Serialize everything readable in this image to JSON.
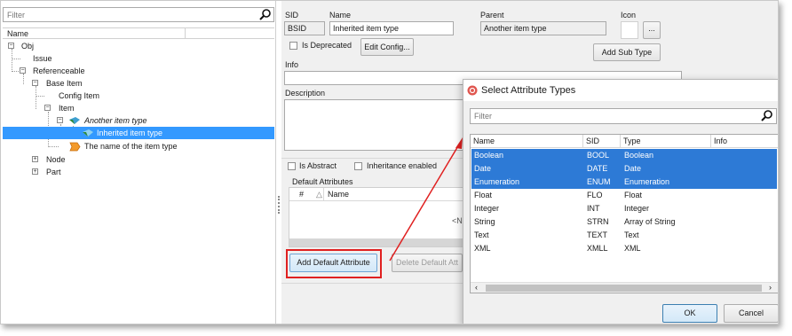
{
  "left_panel": {
    "filter_placeholder": "Filter",
    "column_header": "Name",
    "tree": [
      {
        "label": "Obj"
      },
      {
        "label": "Issue"
      },
      {
        "label": "Referenceable"
      },
      {
        "label": "Base Item"
      },
      {
        "label": "Config Item"
      },
      {
        "label": "Item"
      },
      {
        "label": "Another item type"
      },
      {
        "label": "Inherited item type"
      },
      {
        "label": "The name of the item type"
      },
      {
        "label": "Node"
      },
      {
        "label": "Part"
      }
    ]
  },
  "details": {
    "sid_label": "SID",
    "sid_value": "BSID",
    "name_label": "Name",
    "name_value": "Inherited item type",
    "parent_label": "Parent",
    "parent_value": "Another item type",
    "icon_label": "Icon",
    "browse_label": "...",
    "is_deprecated_label": "Is Deprecated",
    "edit_config_label": "Edit Config...",
    "add_sub_type_label": "Add Sub Type",
    "info_label": "Info",
    "description_label": "Description",
    "is_abstract_label": "Is Abstract",
    "inheritance_enabled_label": "Inheritance enabled",
    "default_attributes_label": "Default Attributes",
    "attr_col_hash": "#",
    "attr_col_sort": "△",
    "attr_col_name": "Name",
    "attr_empty_hint": "<N",
    "add_default_attribute_label": "Add Default Attribute",
    "delete_default_attribute_label": "Delete Default Att"
  },
  "dialog": {
    "title": "Select Attribute Types",
    "filter_placeholder": "Filter",
    "columns": [
      "Name",
      "SID",
      "Type",
      "Info"
    ],
    "rows": [
      {
        "name": "Boolean",
        "sid": "BOOL",
        "type": "Boolean",
        "info": "",
        "selected": true
      },
      {
        "name": "Date",
        "sid": "DATE",
        "type": "Date",
        "info": "",
        "selected": true
      },
      {
        "name": "Enumeration",
        "sid": "ENUM",
        "type": "Enumeration",
        "info": "",
        "selected": true
      },
      {
        "name": "Float",
        "sid": "FLO",
        "type": "Float",
        "info": "",
        "selected": false
      },
      {
        "name": "Integer",
        "sid": "INT",
        "type": "Integer",
        "info": "",
        "selected": false
      },
      {
        "name": "String",
        "sid": "STRN",
        "type": "Array of String",
        "info": "",
        "selected": false
      },
      {
        "name": "Text",
        "sid": "TEXT",
        "type": "Text",
        "info": "",
        "selected": false
      },
      {
        "name": "XML",
        "sid": "XMLL",
        "type": "XML",
        "info": "",
        "selected": false
      }
    ],
    "ok_label": "OK",
    "cancel_label": "Cancel"
  },
  "colors": {
    "selection": "#2d7ad6",
    "tree_selection": "#3399ff",
    "highlight_border": "#e02020",
    "arrow": "#e02020"
  }
}
